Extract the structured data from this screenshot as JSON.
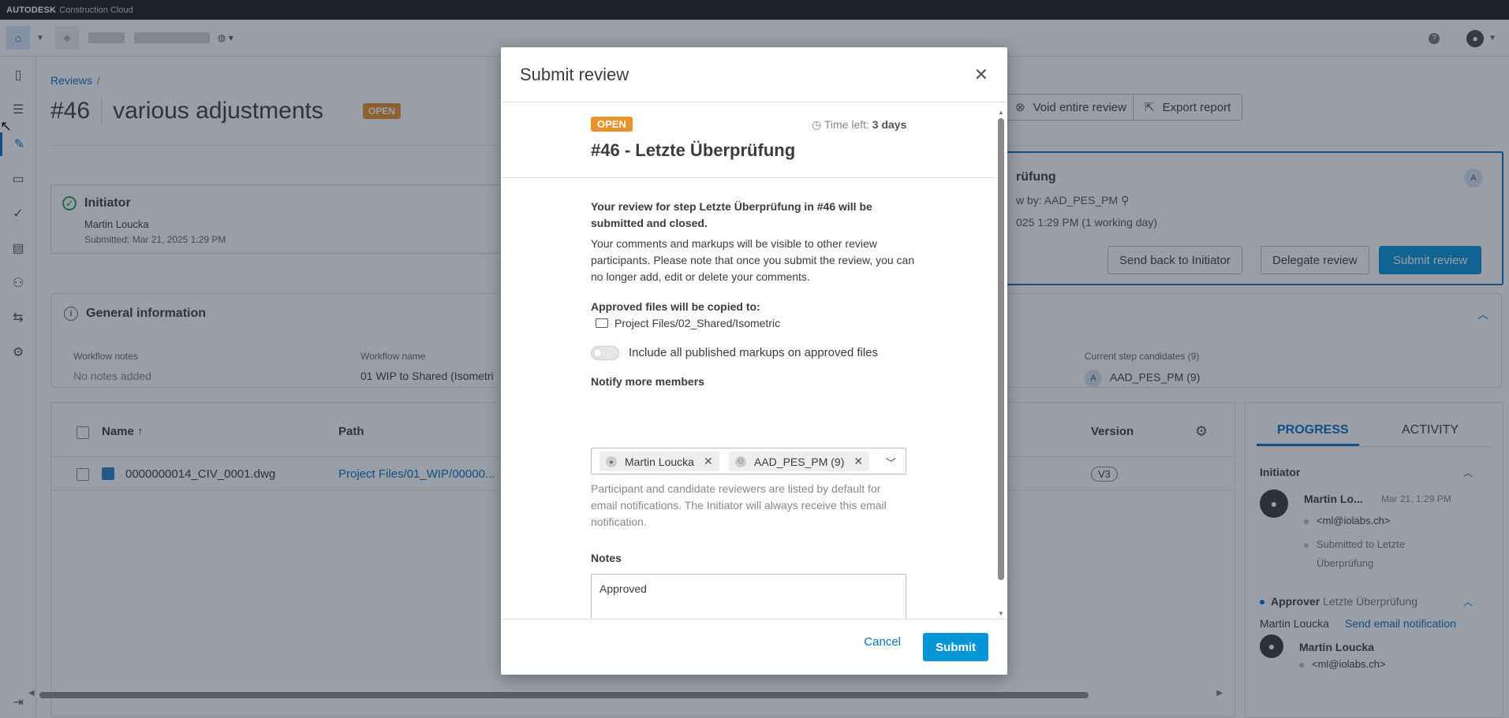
{
  "app": {
    "brand_bold": "AUTODESK",
    "brand_light": "Construction Cloud"
  },
  "page": {
    "breadcrumb": {
      "link": "Reviews",
      "sep": "/"
    },
    "title_number": "#46",
    "title": "various adjustments",
    "status_badge": "OPEN",
    "void_label": "Void entire review",
    "export_label": "Export report",
    "initiator": {
      "heading": "Initiator",
      "name": "Martin Loucka",
      "submitted": "Submitted: Mar 21, 2025 1:29 PM"
    },
    "step": {
      "title_fragment": "rüfung",
      "review_by": "w by: AAD_PES_PM",
      "due": "025 1:29 PM (1 working day)",
      "avatar": "A",
      "send_back_label": "Send back to Initiator",
      "delegate_label": "Delegate review",
      "submit_label": "Submit review"
    },
    "general": {
      "heading": "General information",
      "workflow_notes_label": "Workflow notes",
      "workflow_notes_value": "No notes added",
      "workflow_name_label": "Workflow name",
      "workflow_name_value": "01 WIP to Shared (Isometri",
      "candidates_label": "Current step candidates (9)",
      "candidates_avatar": "A",
      "candidates_value": "AAD_PES_PM (9)"
    },
    "files": {
      "columns": {
        "name": "Name",
        "path": "Path",
        "version": "Version"
      },
      "rows": [
        {
          "name": "0000000014_CIV_0001.dwg",
          "path": "Project Files/01_WIP/00000...",
          "version": "V3"
        }
      ]
    },
    "progress": {
      "tab_progress": "PROGRESS",
      "tab_activity": "ACTIVITY",
      "initiator_heading": "Initiator",
      "initiator_name": "Martin Lo...",
      "initiator_date": "Mar 21, 1:29 PM",
      "initiator_email": "<ml@iolabs.ch>",
      "initiator_action_1": "Submitted to Letzte",
      "initiator_action_2": "Überprüfung",
      "approver_label": "Approver",
      "approver_step": "Letzte Überprüfung",
      "approver_name": "Martin Loucka",
      "send_email": "Send email notification",
      "approver_person": "Martin Loucka",
      "approver_email": "<ml@iolabs.ch>"
    }
  },
  "modal": {
    "title": "Submit review",
    "badge": "OPEN",
    "time_left_label": "Time left:",
    "time_left_value": "3 days",
    "step_title": "#46 - Letzte Überprüfung",
    "intro": "Your review for step Letzte Überprüfung in #46 will be submitted and closed.",
    "visibility": "Your comments and markups will be visible to other review participants. Please note that once you submit the review, you can no longer add, edit or delete your comments.",
    "copied_label": "Approved files will be copied to:",
    "copied_path": "Project Files/02_Shared/Isometric",
    "toggle_label": "Include all published markups on approved files",
    "notify_label": "Notify more members",
    "chips": [
      "Martin Loucka",
      "AAD_PES_PM (9)"
    ],
    "notify_help": "Participant and candidate reviewers are listed by default for email notifications. The Initiator will always receive this email notification.",
    "notes_label": "Notes",
    "notes_value": "Approved",
    "cancel_label": "Cancel",
    "submit_label": "Submit"
  }
}
